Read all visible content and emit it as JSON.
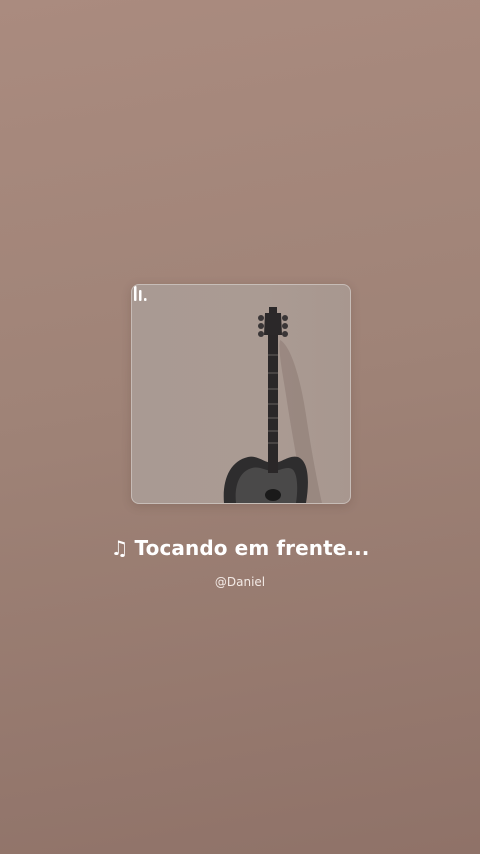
{
  "player": {
    "title": "Tocando em frente...",
    "title_icon": "music-note-icon",
    "artist": "@Daniel",
    "cover_icon": "guitar-icon",
    "playing_icon": "audio-bars-icon"
  },
  "colors": {
    "background": "#a08478",
    "cover_background": "#aa9a93",
    "text": "#ffffff"
  }
}
